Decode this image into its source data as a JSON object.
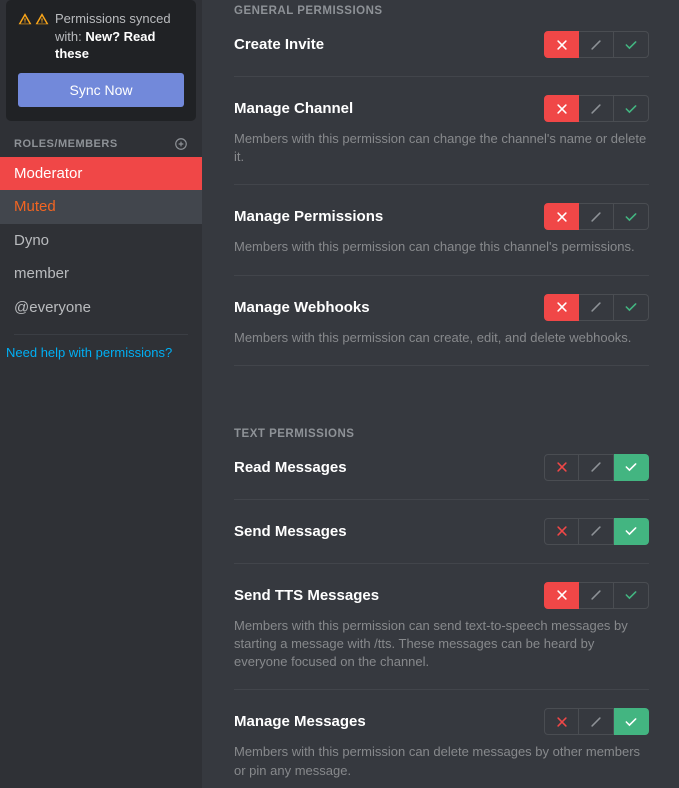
{
  "sidebar": {
    "sync": {
      "text_prefix": "Permissions synced with: ",
      "text_bold": "New? Read these",
      "button": "Sync Now"
    },
    "roles_header": "ROLES/MEMBERS",
    "roles": [
      {
        "label": "Moderator",
        "selected": true,
        "color": "selected"
      },
      {
        "label": "Muted",
        "selected": false,
        "color": "muted"
      },
      {
        "label": "Dyno",
        "selected": false,
        "color": "normal"
      },
      {
        "label": "member",
        "selected": false,
        "color": "normal"
      },
      {
        "label": "@everyone",
        "selected": false,
        "color": "normal"
      }
    ],
    "help_link": "Need help with permissions?"
  },
  "sections": [
    {
      "header": "GENERAL PERMISSIONS",
      "perms": [
        {
          "title": "Create Invite",
          "desc": "",
          "state": "deny"
        },
        {
          "title": "Manage Channel",
          "desc": "Members with this permission can change the channel's name or delete it.",
          "state": "deny"
        },
        {
          "title": "Manage Permissions",
          "desc": "Members with this permission can change this channel's permissions.",
          "state": "deny"
        },
        {
          "title": "Manage Webhooks",
          "desc": "Members with this permission can create, edit, and delete webhooks.",
          "state": "deny"
        }
      ]
    },
    {
      "header": "TEXT PERMISSIONS",
      "perms": [
        {
          "title": "Read Messages",
          "desc": "",
          "state": "allow"
        },
        {
          "title": "Send Messages",
          "desc": "",
          "state": "allow"
        },
        {
          "title": "Send TTS Messages",
          "desc": "Members with this permission can send text-to-speech messages by starting a message with /tts. These messages can be heard by everyone focused on the channel.",
          "state": "deny"
        },
        {
          "title": "Manage Messages",
          "desc": "Members with this permission can delete messages by other members or pin any message.",
          "state": "allow"
        }
      ]
    }
  ],
  "colors": {
    "deny": "#f04747",
    "allow": "#43b581",
    "accent": "#7289da",
    "link": "#00aff4"
  }
}
